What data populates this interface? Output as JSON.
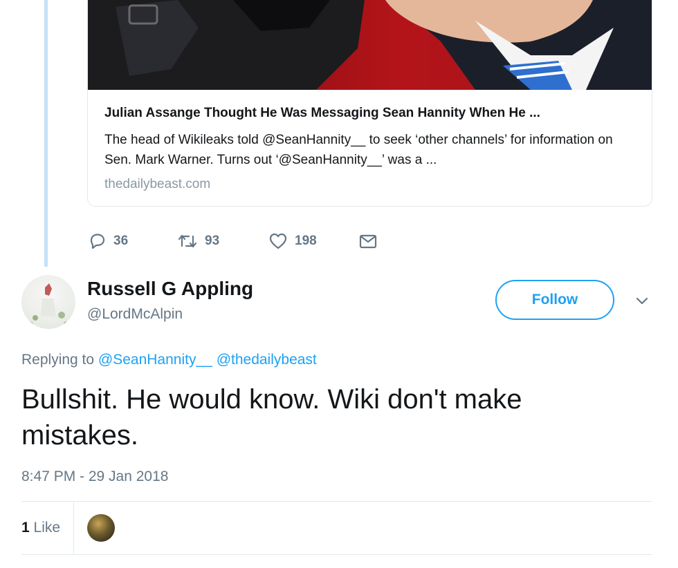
{
  "card": {
    "title": "Julian Assange Thought He Was Messaging Sean Hannity When He ...",
    "description": "The head of Wikileaks told @SeanHannity__ to seek ‘other channels’ for information on Sen. Mark Warner. Turns out ‘@SeanHannity__’ was a ...",
    "domain": "thedailybeast.com"
  },
  "actions": {
    "replies": "36",
    "retweets": "93",
    "likes": "198",
    "icons": [
      "reply-icon",
      "retweet-icon",
      "like-icon",
      "message-icon"
    ]
  },
  "reply": {
    "display_name": "Russell G Appling",
    "handle": "@LordMcAlpin",
    "follow_label": "Follow",
    "replying_prefix": "Replying to",
    "replying_to": [
      "@SeanHannity__",
      "@thedailybeast"
    ],
    "text": "Bullshit. He would know. Wiki don't make mistakes.",
    "timestamp": "8:47 PM - 29 Jan 2018",
    "like_count": "1",
    "like_label": "Like"
  },
  "colors": {
    "accent": "#1da1f2",
    "secondary_text": "#657786",
    "thread_line": "#c4e1f8"
  }
}
